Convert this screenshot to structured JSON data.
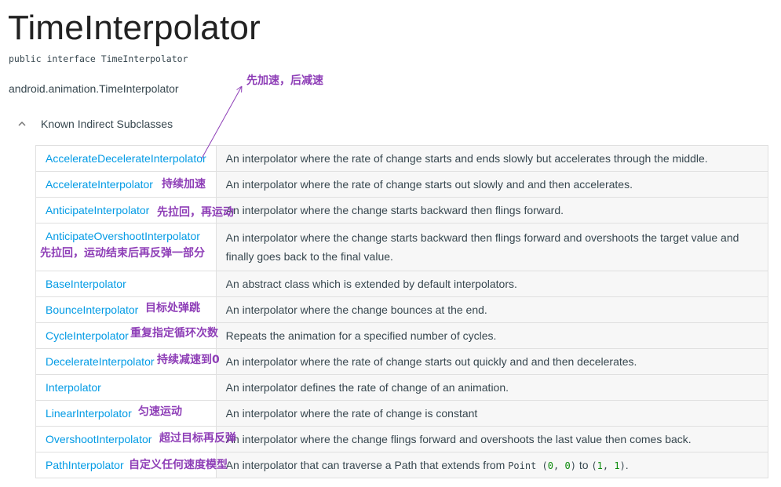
{
  "header": {
    "title": "TimeInterpolator",
    "signature": "public interface TimeInterpolator",
    "package": "android.animation.TimeInterpolator"
  },
  "subclasses": {
    "toggle_label": "Known Indirect Subclasses",
    "toggle_icon": "chevron-up-icon",
    "rows": [
      {
        "name": "AccelerateDecelerateInterpolator",
        "desc": "An interpolator where the rate of change starts and ends slowly but accelerates through the middle."
      },
      {
        "name": "AccelerateInterpolator",
        "desc": "An interpolator where the rate of change starts out slowly and and then accelerates."
      },
      {
        "name": "AnticipateInterpolator",
        "desc": "An interpolator where the change starts backward then flings forward."
      },
      {
        "name": "AnticipateOvershootInterpolator",
        "desc": "An interpolator where the change starts backward then flings forward and overshoots the target value and finally goes back to the final value."
      },
      {
        "name": "BaseInterpolator",
        "desc": "An abstract class which is extended by default interpolators."
      },
      {
        "name": "BounceInterpolator",
        "desc": "An interpolator where the change bounces at the end."
      },
      {
        "name": "CycleInterpolator",
        "desc": "Repeats the animation for a specified number of cycles."
      },
      {
        "name": "DecelerateInterpolator",
        "desc": "An interpolator where the rate of change starts out quickly and and then decelerates."
      },
      {
        "name": "Interpolator",
        "desc": "An interpolator defines the rate of change of an animation."
      },
      {
        "name": "LinearInterpolator",
        "desc": "An interpolator where the rate of change is constant"
      },
      {
        "name": "OvershootInterpolator",
        "desc": "An interpolator where the change flings forward and overshoots the last value then comes back."
      },
      {
        "name": "PathInterpolator",
        "desc_prefix": "An interpolator that can traverse a Path that extends from ",
        "code1": "Point (0, 0)",
        "desc_mid": " to ",
        "code2": "(1, 1)",
        "desc_suffix": "."
      }
    ]
  },
  "annotations": {
    "arrow_note": "先加速，后减速",
    "accelerate": "持续加速",
    "anticipate": "先拉回，再运动",
    "anticipate_overshoot": "先拉回，运动结束后再反弹一部分",
    "bounce": "目标处弹跳",
    "cycle": "重复指定循环次数",
    "decelerate": "持续减速到0",
    "linear": "匀速运动",
    "overshoot": "超过目标再反弹",
    "path": "自定义任何速度模型"
  },
  "colors": {
    "link": "#039be5",
    "annotation": "#8e3eb7",
    "desc_bg": "#f7f7f7",
    "border": "#e0e0e0"
  }
}
